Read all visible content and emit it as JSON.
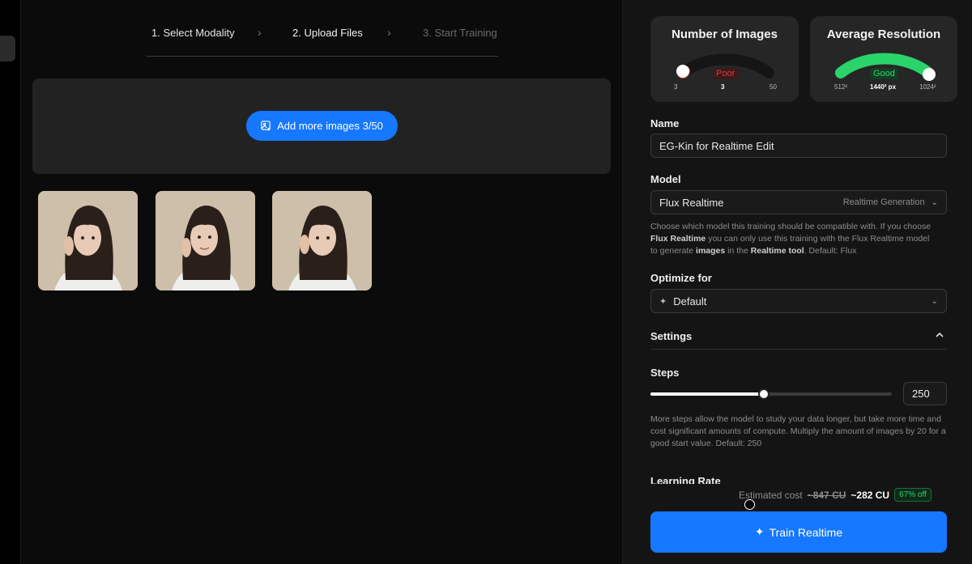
{
  "stepper": {
    "steps": [
      {
        "label": "1. Select Modality",
        "state": "done"
      },
      {
        "label": "2. Upload Files",
        "state": "active"
      },
      {
        "label": "3. Start Training",
        "state": "disabled"
      }
    ]
  },
  "upload": {
    "add_label": "Add more images 3/50",
    "images": [
      {
        "icon": "portrait-image"
      },
      {
        "icon": "portrait-image"
      },
      {
        "icon": "portrait-image"
      }
    ]
  },
  "gauges": {
    "count": {
      "title": "Number of Images",
      "min_label": "3",
      "value_label": "3",
      "max_label": "50",
      "status": "Poor",
      "value": 3,
      "min": 3,
      "max": 50,
      "color": "#e2363a"
    },
    "resolution": {
      "title": "Average Resolution",
      "min_label": "512²",
      "value_label": "1440² px",
      "max_label": "1024²",
      "status": "Good",
      "level": 1.0,
      "color": "#2bd46a"
    }
  },
  "form": {
    "name_label": "Name",
    "name_value": "EG-Kin for Realtime Edit",
    "model_label": "Model",
    "model_value": "Flux Realtime",
    "model_tag": "Realtime Generation",
    "model_help_1": "Choose which model this training should be compatible with. If you choose",
    "model_help_bold_1": "Flux Realtime",
    "model_help_2": " you can only use this training with the Flux Realtime model",
    "model_help_3": "to generate ",
    "model_help_bold_2": "images",
    "model_help_4": " in the ",
    "model_help_bold_3": "Realtime tool",
    "model_help_5": ". Default: Flux",
    "optimize_label": "Optimize for",
    "optimize_value": "Default",
    "settings_label": "Settings",
    "steps_label": "Steps",
    "steps_value": "250",
    "steps_fraction": 0.47,
    "steps_help": "More steps allow the model to study your data longer, but take more time and cost significant amounts of compute. Multiply the amount of images by 20 for a good start value. Default: 250",
    "learning_rate_label": "Learning Rate"
  },
  "cost": {
    "label": "Estimated cost",
    "old": "~847 CU",
    "new": "~282 CU",
    "discount": "67% off"
  },
  "train_button": "Train Realtime",
  "colors": {
    "accent": "#1677ff",
    "good": "#2bd46a",
    "poor": "#e2363a"
  }
}
